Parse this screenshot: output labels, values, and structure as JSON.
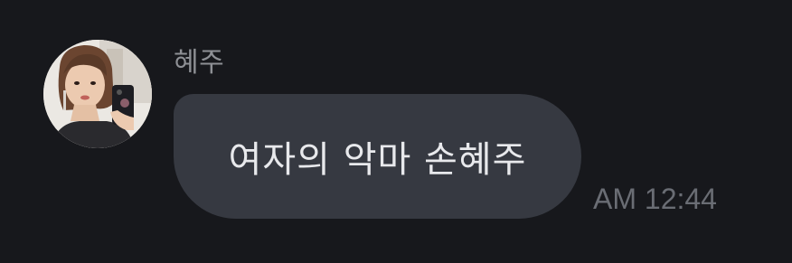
{
  "message": {
    "sender_name": "혜주",
    "avatar": {
      "icon": "profile-photo-icon",
      "description_colors": {
        "background": "#e9e6e2",
        "hair": "#5a3a2a",
        "skin": "#e8c4a8",
        "phone": "#1d1d22"
      }
    },
    "text": "여자의 악마 손혜주",
    "time": "AM 12:44"
  },
  "colors": {
    "background": "#17181c",
    "bubble": "#363941",
    "message_text": "#e8e9ec",
    "sender_name": "#8e9095",
    "timestamp": "#6a6d74"
  }
}
